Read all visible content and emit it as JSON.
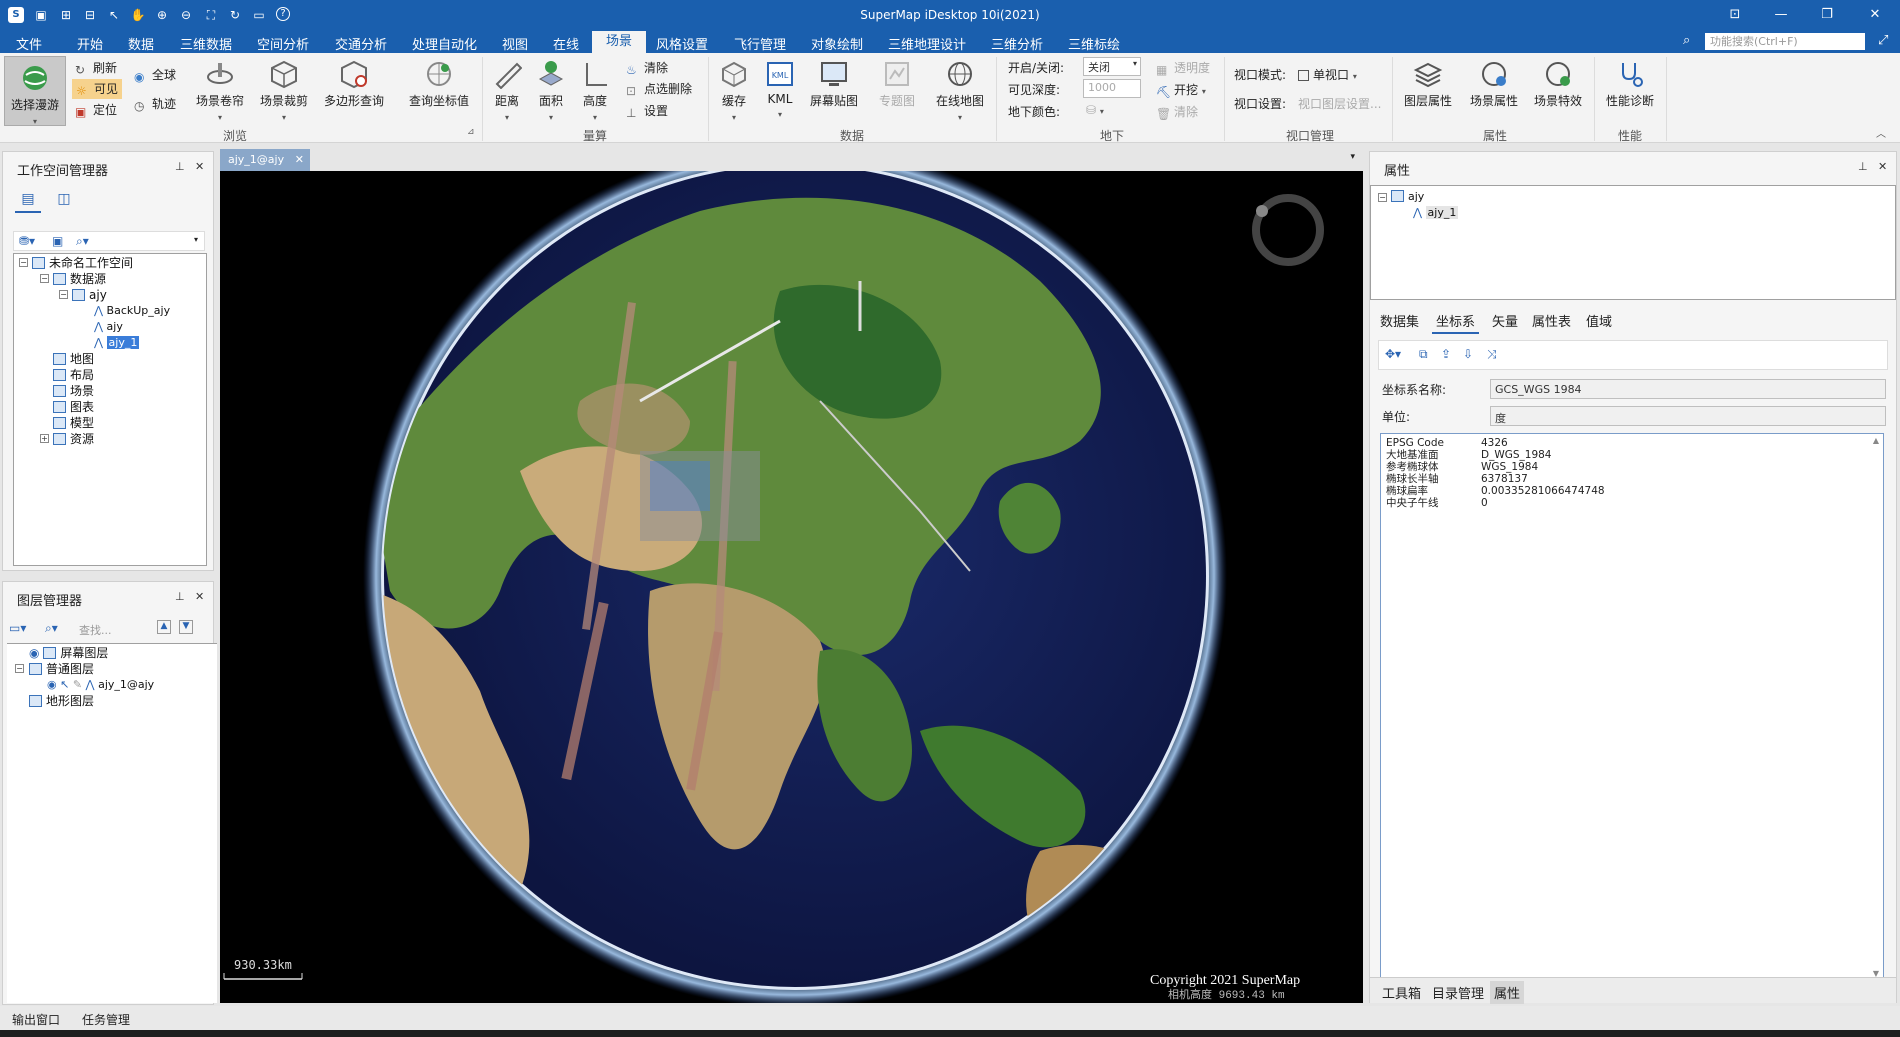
{
  "app": {
    "title": "SuperMap iDesktop 10i(2021)"
  },
  "menu": {
    "items": [
      "文件",
      "开始",
      "数据",
      "三维数据",
      "空间分析",
      "交通分析",
      "处理自动化",
      "视图",
      "在线",
      "场景",
      "风格设置",
      "飞行管理",
      "对象绘制",
      "三维地理设计",
      "三维分析",
      "三维标绘"
    ],
    "search_placeholder": "功能搜索(Ctrl+F)"
  },
  "ribbon": {
    "browse": {
      "pan": "选择漫游",
      "refresh": "刷新",
      "visible": "可见",
      "locate": "定位",
      "globe": "全球",
      "track": "轨迹",
      "roller": "场景卷帘",
      "clip": "场景裁剪",
      "polyquery": "多边形查询",
      "coordquery": "查询坐标值",
      "group": "浏览"
    },
    "measure": {
      "distance": "距离",
      "area": "面积",
      "height": "高度",
      "clear": "清除",
      "pointclear": "点选删除",
      "settings": "设置",
      "group": "量算"
    },
    "data": {
      "cache": "缓存",
      "kml": "KML",
      "kml_icon_text": "KML",
      "screen": "屏幕贴图",
      "thematic": "专题图",
      "online": "在线地图",
      "group": "数据"
    },
    "underground": {
      "onoff_label": "开启/关闭:",
      "onoff_value": "关闭",
      "depth_label": "可见深度:",
      "depth_value": "1000",
      "color_label": "地下颜色:",
      "transparency": "透明度",
      "excavate": "开挖",
      "clear": "清除",
      "group": "地下"
    },
    "viewport": {
      "mode_label": "视口模式:",
      "mode_value": "单视口",
      "settings_label": "视口设置:",
      "settings_value": "视口图层设置...",
      "group": "视口管理"
    },
    "attrs": {
      "layer": "图层属性",
      "scene": "场景属性",
      "effect": "场景特效",
      "group": "属性"
    },
    "perf": {
      "diag": "性能诊断",
      "group": "性能"
    }
  },
  "workspace": {
    "title": "工作空间管理器",
    "tree": [
      "未命名工作空间",
      "数据源",
      "ajy",
      "BackUp_ajy",
      "ajy",
      "ajy_1",
      "地图",
      "布局",
      "场景",
      "图表",
      "模型",
      "资源"
    ]
  },
  "layers": {
    "title": "图层管理器",
    "search_placeholder": "查找...",
    "tree": [
      "屏幕图层",
      "普通图层",
      "ajy_1@ajy",
      "地形图层"
    ]
  },
  "document": {
    "tab": "ajy_1@ajy",
    "scale": "930.33km",
    "copyright": "Copyright 2021 SuperMap",
    "camera": "相机高度 9693.43 km"
  },
  "properties": {
    "title": "属性",
    "tree": [
      "ajy",
      "ajy_1"
    ],
    "tabs": [
      "数据集",
      "坐标系",
      "矢量",
      "属性表",
      "值域"
    ],
    "cs_name_label": "坐标系名称:",
    "cs_name": "GCS_WGS 1984",
    "unit_label": "单位:",
    "unit": "度",
    "wkt": [
      {
        "k": "EPSG Code",
        "v": "4326"
      },
      {
        "k": "大地基准面",
        "v": "D_WGS_1984"
      },
      {
        "k": "参考椭球体",
        "v": "WGS_1984"
      },
      {
        "k": "椭球长半轴",
        "v": "6378137"
      },
      {
        "k": "椭球扁率",
        "v": "0.00335281066474748"
      },
      {
        "k": "中央子午线",
        "v": "0"
      }
    ],
    "bottom_tabs": [
      "工具箱",
      "目录管理",
      "属性"
    ]
  },
  "status": {
    "output": "输出窗口",
    "tasks": "任务管理"
  },
  "colors": {
    "accent": "#1a5fae",
    "space": "#000000",
    "ocean": "#101a4e"
  }
}
